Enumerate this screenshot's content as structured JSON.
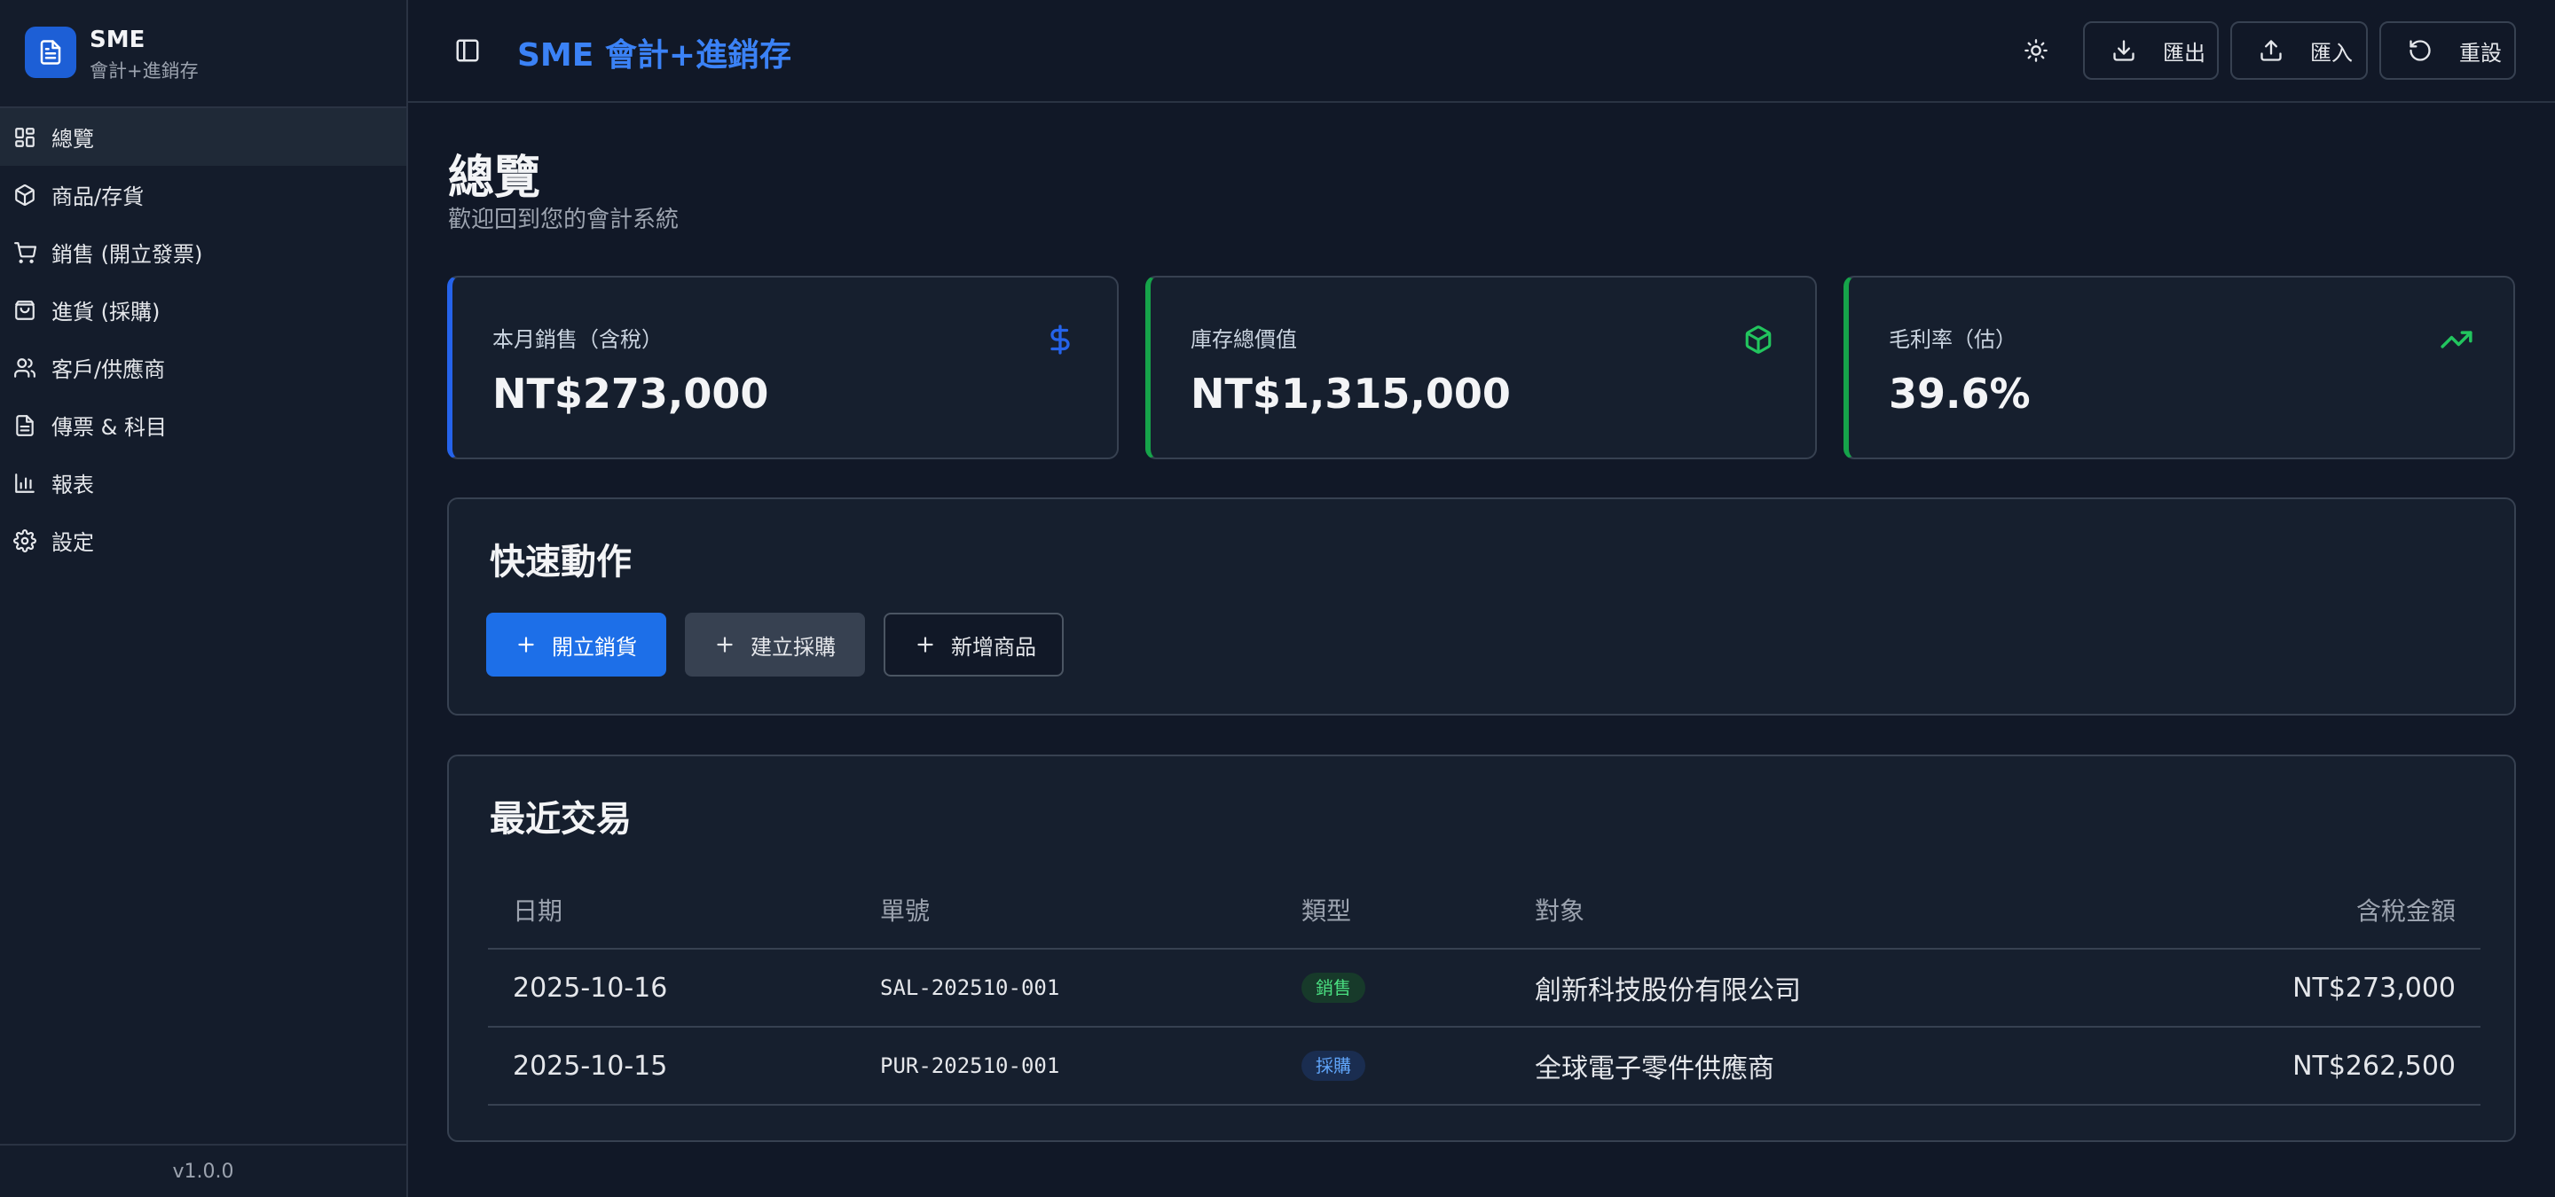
{
  "brand": {
    "title": "SME",
    "subtitle": "會計+進銷存"
  },
  "sidebar": {
    "items": [
      {
        "label": "總覽",
        "icon": "dashboard-icon"
      },
      {
        "label": "商品/存貨",
        "icon": "box-icon"
      },
      {
        "label": "銷售 (開立發票)",
        "icon": "cart-icon"
      },
      {
        "label": "進貨 (採購)",
        "icon": "bag-icon"
      },
      {
        "label": "客戶/供應商",
        "icon": "users-icon"
      },
      {
        "label": "傳票 & 科目",
        "icon": "document-icon"
      },
      {
        "label": "報表",
        "icon": "bar-chart-icon"
      },
      {
        "label": "設定",
        "icon": "gear-icon"
      }
    ],
    "version": "v1.0.0"
  },
  "topbar": {
    "title": "SME 會計+進銷存",
    "export_label": "匯出",
    "import_label": "匯入",
    "reset_label": "重設"
  },
  "page": {
    "title": "總覽",
    "subtitle": "歡迎回到您的會計系統"
  },
  "cards": [
    {
      "label": "本月銷售（含稅）",
      "value": "NT$273,000",
      "icon": "dollar-icon",
      "color": "#2563eb"
    },
    {
      "label": "庫存總價值",
      "value": "NT$1,315,000",
      "icon": "box-icon",
      "color": "#22c55e"
    },
    {
      "label": "毛利率（估）",
      "value": "39.6%",
      "icon": "trending-up-icon",
      "color": "#22c55e"
    }
  ],
  "quick_actions": {
    "title": "快速動作",
    "sale": "開立銷貨",
    "purchase": "建立採購",
    "product": "新增商品"
  },
  "transactions": {
    "title": "最近交易",
    "headers": {
      "date": "日期",
      "no": "單號",
      "type": "類型",
      "party": "對象",
      "amount": "含稅金額"
    },
    "rows": [
      {
        "date": "2025-10-16",
        "no": "SAL-202510-001",
        "type": "銷售",
        "party": "創新科技股份有限公司",
        "amount": "NT$273,000"
      },
      {
        "date": "2025-10-15",
        "no": "PUR-202510-001",
        "type": "採購",
        "party": "全球電子零件供應商",
        "amount": "NT$262,500"
      }
    ]
  }
}
